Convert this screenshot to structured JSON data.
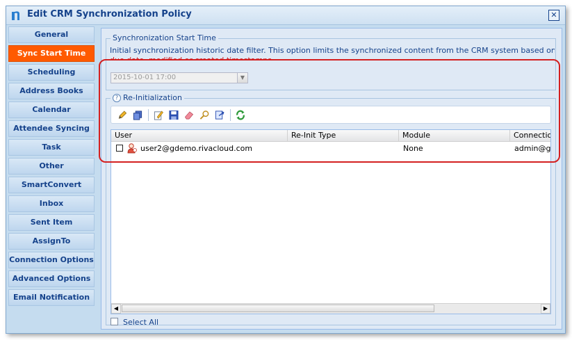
{
  "window": {
    "title": "Edit CRM Synchronization Policy",
    "close_symbol": "✕"
  },
  "nav": {
    "items": [
      {
        "label": "General"
      },
      {
        "label": "Sync Start Time"
      },
      {
        "label": "Scheduling"
      },
      {
        "label": "Address Books"
      },
      {
        "label": "Calendar"
      },
      {
        "label": "Attendee Syncing"
      },
      {
        "label": "Task"
      },
      {
        "label": "Other"
      },
      {
        "label": "SmartConvert"
      },
      {
        "label": "Inbox"
      },
      {
        "label": "Sent Item"
      },
      {
        "label": "AssignTo"
      },
      {
        "label": "Connection Options"
      },
      {
        "label": "Advanced Options"
      },
      {
        "label": "Email Notification"
      }
    ],
    "active_index": 1,
    "active_color": "#ff5a00"
  },
  "sync_start": {
    "legend": "Synchronization Start Time",
    "description": "Initial synchronization historic date filter.  This option limits the synchronized content from the CRM system based on the start date,",
    "description_continued": "due date, modified or created timestamps.",
    "date_value": "2015-10-01 17:00"
  },
  "reinit": {
    "legend": "Re-Initialization",
    "toolbar_icons": [
      "pencil-icon",
      "copy-icon",
      "edit-document-icon",
      "save-icon",
      "eraser-icon",
      "search-icon",
      "export-icon",
      "refresh-icon"
    ],
    "columns": [
      "User",
      "Re-Init Type",
      "Module",
      "Connection"
    ],
    "rows": [
      {
        "user": "user2@gdemo.rivacloud.com",
        "reinit_type": "",
        "module": "None",
        "connection": "admin@gdemo"
      }
    ],
    "select_all_label": "Select All"
  },
  "colors": {
    "highlight": "#d42020",
    "title_text": "#15428b"
  }
}
